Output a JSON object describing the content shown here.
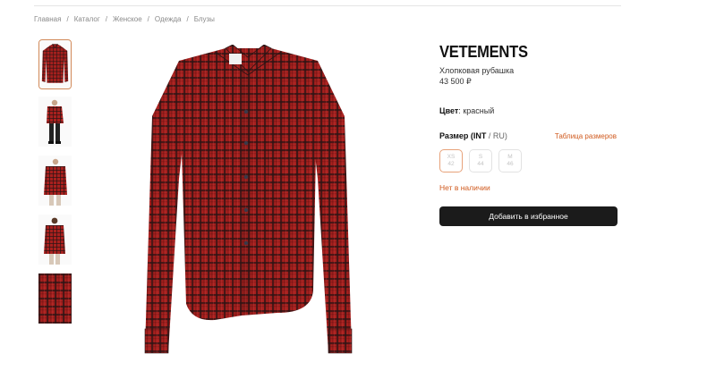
{
  "breadcrumb": [
    "Главная",
    "Каталог",
    "Женское",
    "Одежда",
    "Блузы"
  ],
  "breadcrumb_separator": "/",
  "product": {
    "brand": "VETEMENTS",
    "name": "Хлопковая рубашка",
    "price": "43 500 ₽",
    "color_label": "Цвет",
    "color_value": "красный",
    "size_label": "Размер (INT",
    "size_label_sub": "/ RU)",
    "size_table_link": "Таблица размеров",
    "sizes": [
      {
        "int": "XS",
        "ru": "42",
        "selected": true
      },
      {
        "int": "S",
        "ru": "44",
        "selected": false
      },
      {
        "int": "M",
        "ru": "46",
        "selected": false
      }
    ],
    "stock_status": "Нет в наличии",
    "favorite_button": "Добавить в избранное"
  },
  "colors": {
    "accent": "#d05a1e",
    "button_bg": "#1b1b1b",
    "shirt_red": "#a8201e",
    "check_dark": "#1e1616"
  },
  "thumbnails": [
    "shirt-flat",
    "model-front-trousers",
    "model-front",
    "model-back",
    "fabric-detail"
  ]
}
